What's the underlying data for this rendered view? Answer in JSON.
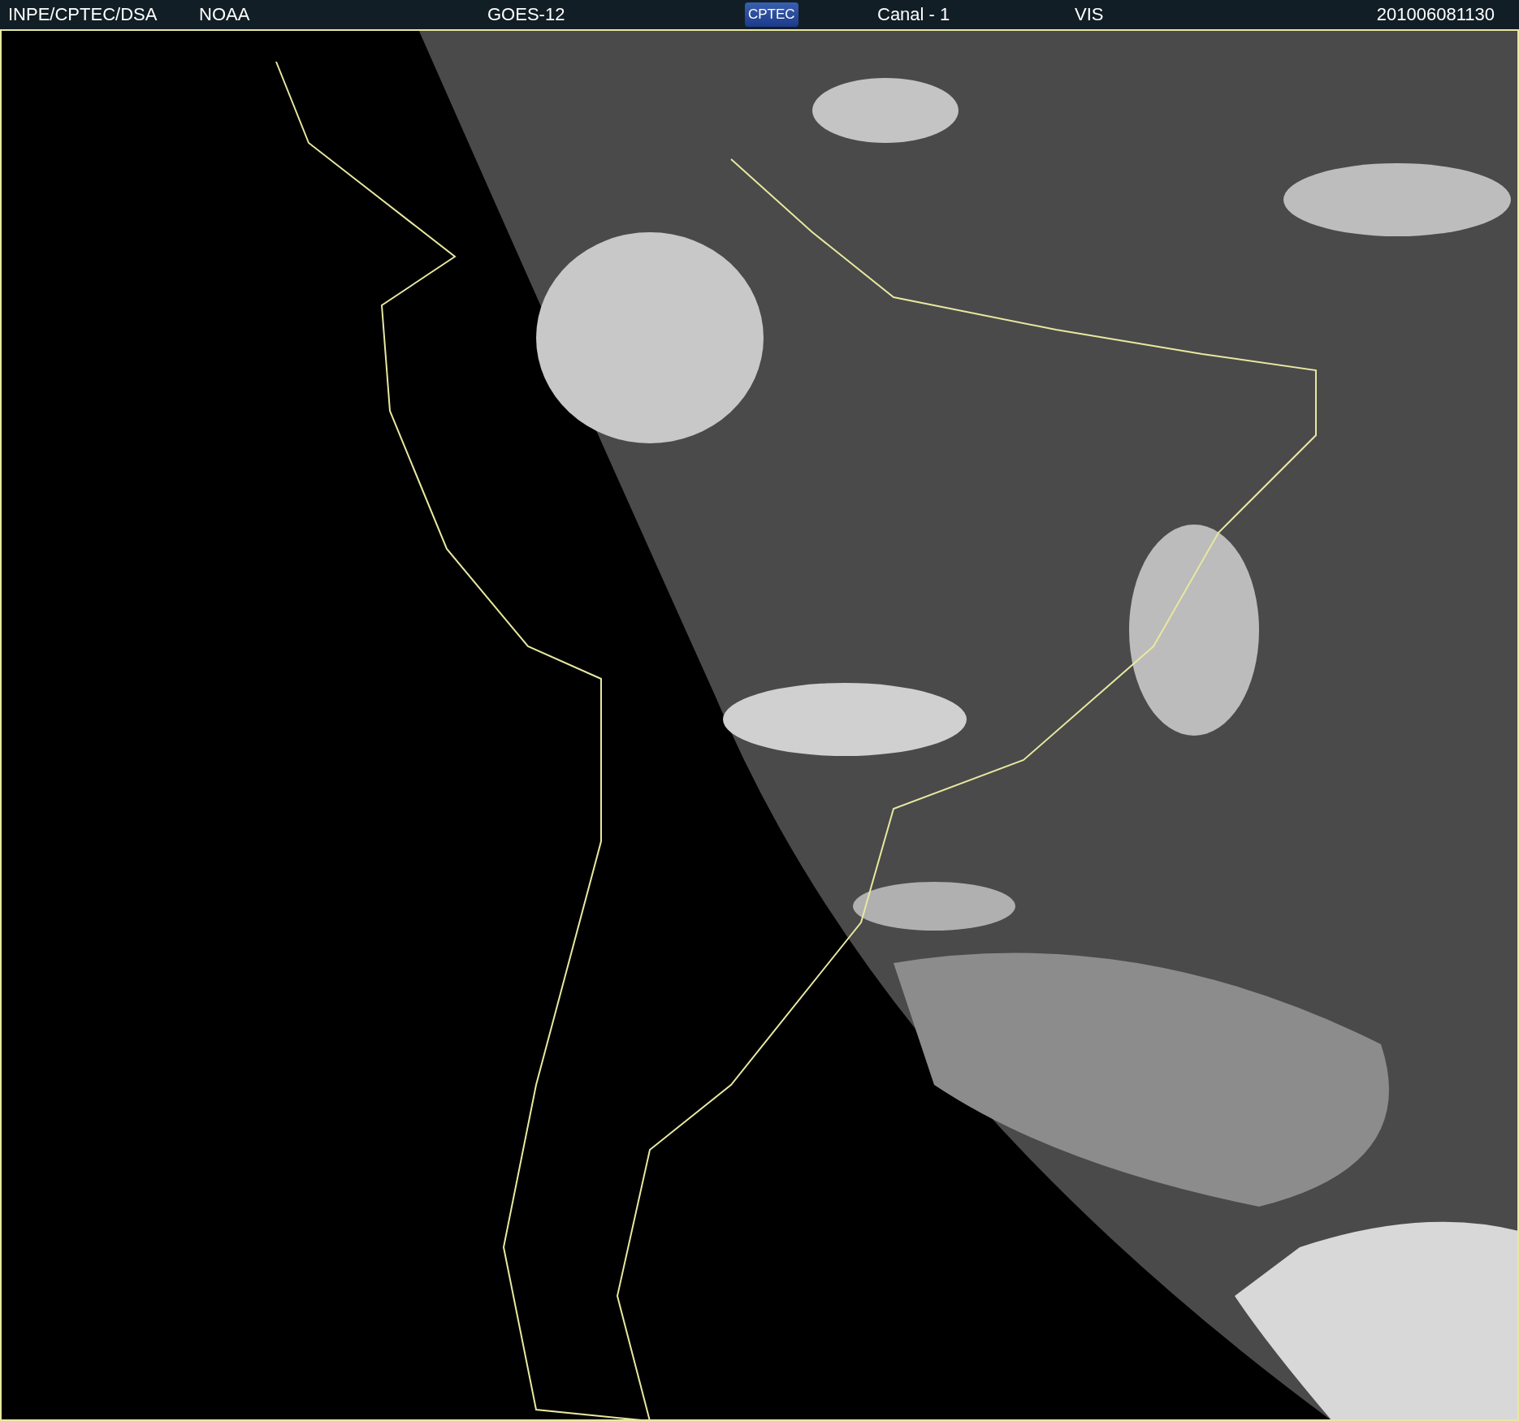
{
  "header": {
    "source": "INPE/CPTEC/DSA",
    "agency": "NOAA",
    "satellite": "GOES-12",
    "logo": "CPTEC",
    "channel": "Canal - 1",
    "band": "VIS",
    "timestamp": "201006081130"
  }
}
